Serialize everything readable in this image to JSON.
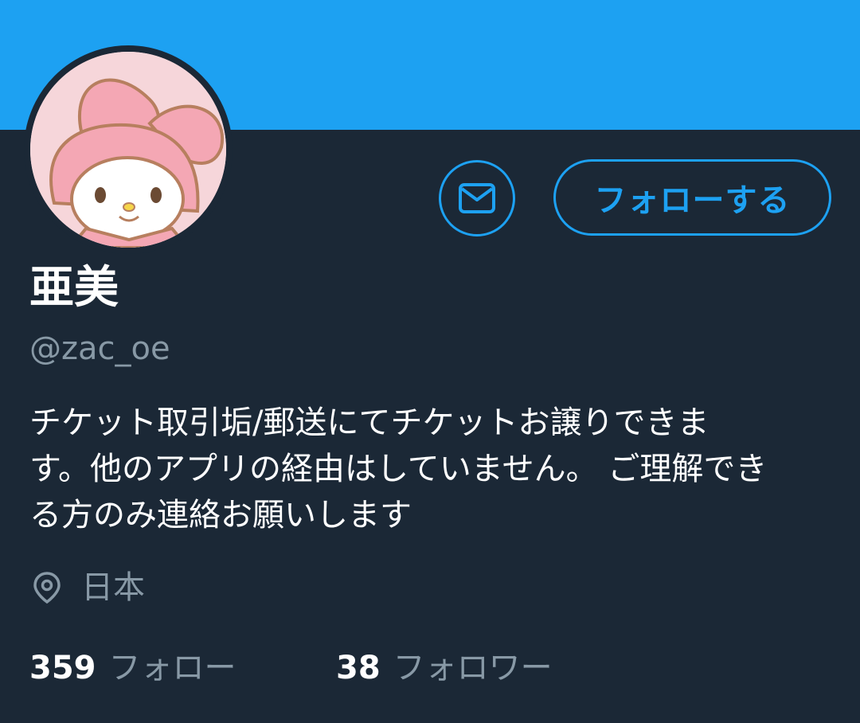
{
  "profile": {
    "display_name": "亜美",
    "handle": "@zac_oe",
    "bio_lines": [
      "チケット取引垢/郵送にてチケットお譲りできま",
      "す。他のアプリの経由はしていません。 ご理解でき",
      "る方のみ連絡お願いします"
    ],
    "location": "日本",
    "avatar_icon": "my-melody-avatar"
  },
  "actions": {
    "dm_icon": "envelope-icon",
    "follow_label": "フォローする"
  },
  "stats": {
    "following_count": "359",
    "following_label": "フォロー",
    "followers_count": "38",
    "followers_label": "フォロワー"
  },
  "colors": {
    "accent": "#1da1f2",
    "background": "#1b2836",
    "secondary_text": "#8899a6",
    "primary_text": "#ffffff"
  }
}
